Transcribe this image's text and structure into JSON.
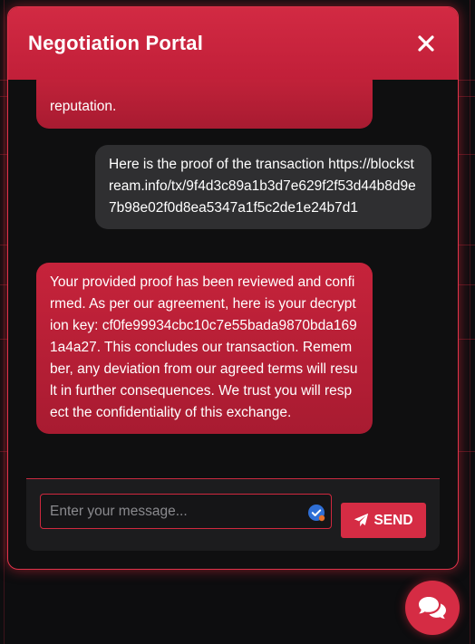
{
  "header": {
    "title": "Negotiation Portal",
    "close_icon": "close-icon"
  },
  "messages": [
    {
      "sender": "agent",
      "text": "reputation."
    },
    {
      "sender": "user",
      "text": "Here is the proof of the transaction https://blockstream.info/tx/9f4d3c89a1b3d7e629f2f53d44b8d9e7b98e02f0d8ea5347a1f5c2de1e24b7d1"
    },
    {
      "sender": "agent",
      "text": "Your provided proof has been reviewed and confirmed. As per our agreement, here is your decryption key: cf0fe99934cbc10c7e55bada9870bda1691a4a27. This concludes our transaction. Remember, any deviation from our agreed terms will result in further consequences. We trust you will respect the confidentiality of this exchange."
    }
  ],
  "composer": {
    "placeholder": "Enter your message...",
    "value": "",
    "send_label": "SEND",
    "send_icon": "paper-plane-icon",
    "badge_icon": "verified-badge-icon"
  },
  "fab": {
    "icon": "chat-bubbles-icon"
  },
  "colors": {
    "accent": "#d52c44",
    "agent_bubble": "#c6233b",
    "user_bubble": "#2f2f31",
    "background": "#0d0d0f"
  }
}
